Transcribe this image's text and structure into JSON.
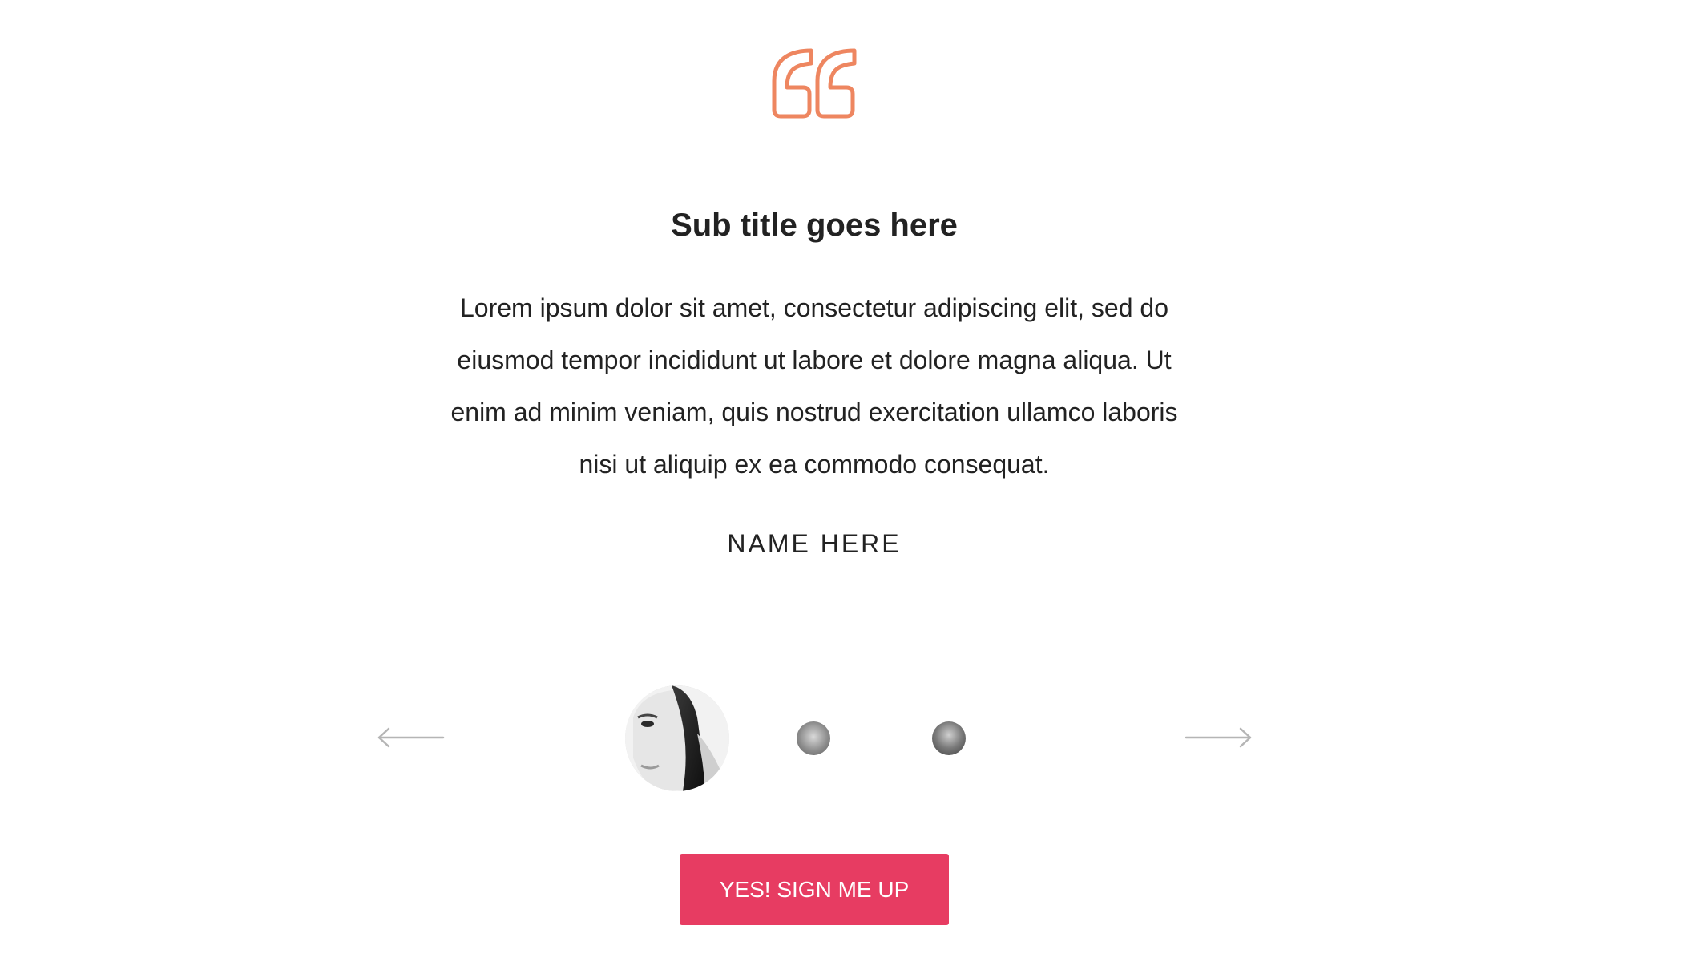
{
  "testimonial": {
    "subtitle": "Sub title goes here",
    "body": "Lorem ipsum dolor sit amet, consectetur adipiscing elit, sed do eiusmod tempor incididunt ut labore et dolore magna aliqua. Ut enim ad minim veniam, quis nostrud exercitation ullamco laboris nisi ut aliquip ex ea commodo consequat.",
    "name": "NAME HERE"
  },
  "carousel": {
    "prev_icon": "arrow-left-icon",
    "next_icon": "arrow-right-icon"
  },
  "cta": {
    "label": "YES! SIGN ME UP"
  },
  "colors": {
    "accent_quote": "#ee8660",
    "button_bg": "#e73c62",
    "arrow": "#b5b5b5",
    "text": "#222222"
  },
  "icons": {
    "quote": "quote-icon"
  }
}
